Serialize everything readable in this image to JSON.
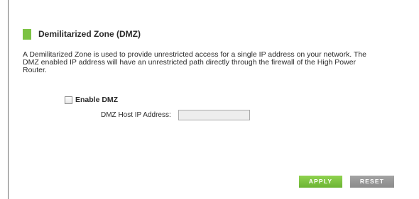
{
  "section": {
    "title": "Demilitarized Zone (DMZ)",
    "marker_color": "#7cc243"
  },
  "description": {
    "line1": "A Demilitarized Zone is used to provide unrestricted access for a single IP address on your network. The",
    "line2": "DMZ enabled IP address will have an unrestricted path directly through the firewall of the High Power",
    "line3": "Router."
  },
  "enable_dmz": {
    "label": "Enable DMZ",
    "checked": false
  },
  "dmz_host": {
    "label": "DMZ Host IP Address:",
    "value": ""
  },
  "buttons": {
    "apply_label": "APPLY",
    "apply_color": "#7cc243",
    "reset_label": "RESET",
    "reset_color": "#999999"
  }
}
